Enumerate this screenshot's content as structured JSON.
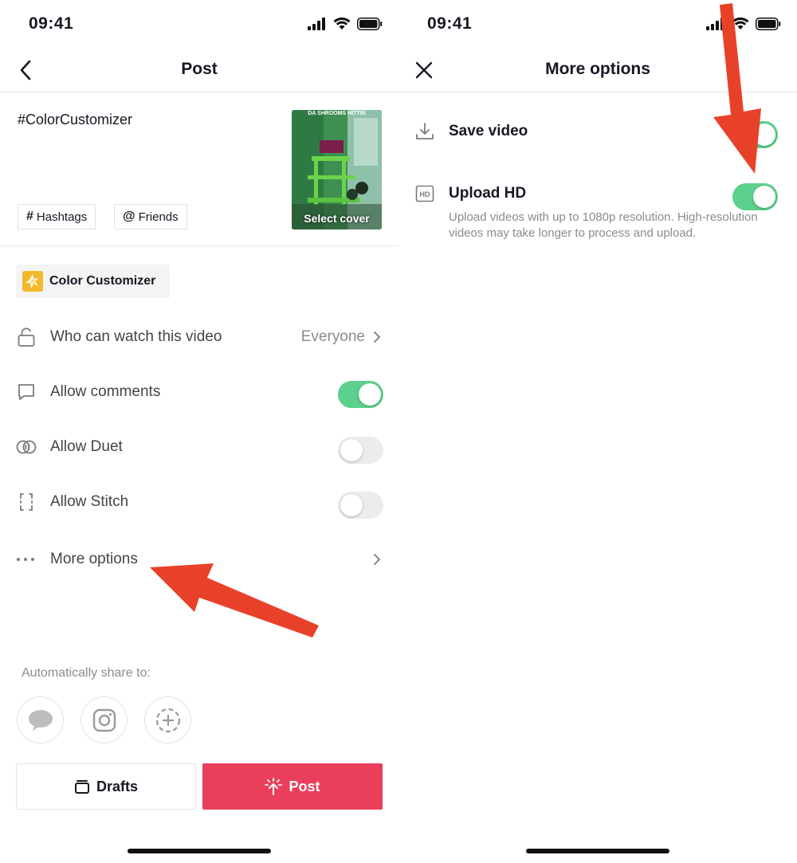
{
  "status": {
    "time": "09:41"
  },
  "left": {
    "nav": {
      "title": "Post"
    },
    "caption": "#ColorCustomizer",
    "chips": {
      "hashtags": "Hashtags",
      "friends": "Friends"
    },
    "cover": {
      "overlay_text": "DA SHROOMS HITTIN",
      "label": "Select cover"
    },
    "effect": {
      "name": "Color Customizer"
    },
    "settings": {
      "who_can_watch": {
        "label": "Who can watch this video",
        "value": "Everyone"
      },
      "allow_comments": {
        "label": "Allow comments",
        "on": true
      },
      "allow_duet": {
        "label": "Allow Duet",
        "on": false
      },
      "allow_stitch": {
        "label": "Allow Stitch",
        "on": false
      },
      "more_options": {
        "label": "More options"
      }
    },
    "share": {
      "label": "Automatically share to:",
      "targets": [
        "messages-icon",
        "instagram-icon",
        "add-story-icon"
      ]
    },
    "buttons": {
      "drafts": "Drafts",
      "post": "Post"
    }
  },
  "right": {
    "nav": {
      "title": "More options"
    },
    "options": {
      "save_video": {
        "label": "Save video",
        "on": true
      },
      "upload_hd": {
        "label": "Upload HD",
        "on": true,
        "description": "Upload videos with up to 1080p resolution. High-resolution videos may take longer to process and upload."
      }
    }
  },
  "colors": {
    "toggle_on": "#5cd08c",
    "post_button": "#ea3f5a",
    "annotation_arrow": "#e8412a"
  }
}
